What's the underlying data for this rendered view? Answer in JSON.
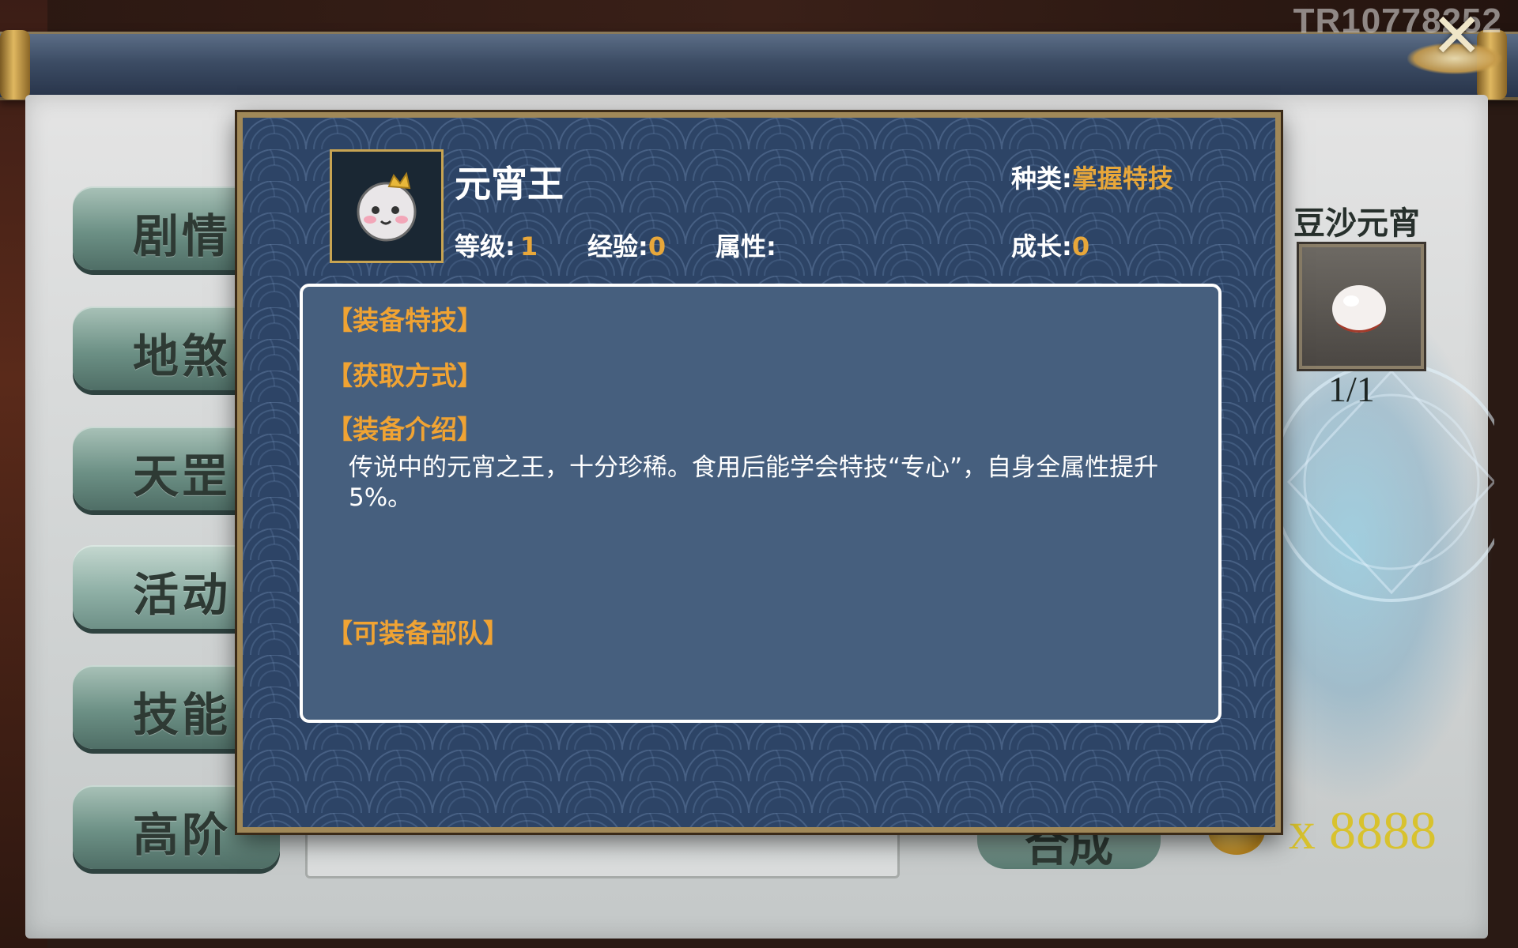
{
  "watermark": "TR10778252",
  "tabs": [
    {
      "label": "剧情"
    },
    {
      "label": "地煞"
    },
    {
      "label": "天罡"
    },
    {
      "label": "活动"
    },
    {
      "label": "技能"
    },
    {
      "label": "高阶"
    }
  ],
  "side_item": {
    "name": "豆沙元宵",
    "count": "1/1"
  },
  "compose_label": "合成",
  "currency": {
    "amount": "x 8888"
  },
  "modal": {
    "item_name": "元宵王",
    "category_label": "种类:",
    "category_value": "掌握特技",
    "level_label": "等级:",
    "level_value": "1",
    "exp_label": "经验:",
    "exp_value": "0",
    "attr_label": "属性:",
    "growth_label": "成长:",
    "growth_value": "0",
    "sections": {
      "skills": "【装备特技】",
      "source": "【获取方式】",
      "intro": "【装备介绍】",
      "troops": "【可装备部队】"
    },
    "description": "传说中的元宵之王，十分珍稀。食用后能学会特技“专心”，自身全属性提升5%。"
  },
  "colors": {
    "accent": "#f0a333",
    "modal_bg": "#2d4466",
    "desc_bg": "#465f7e",
    "coin_text": "#d8c22e"
  }
}
